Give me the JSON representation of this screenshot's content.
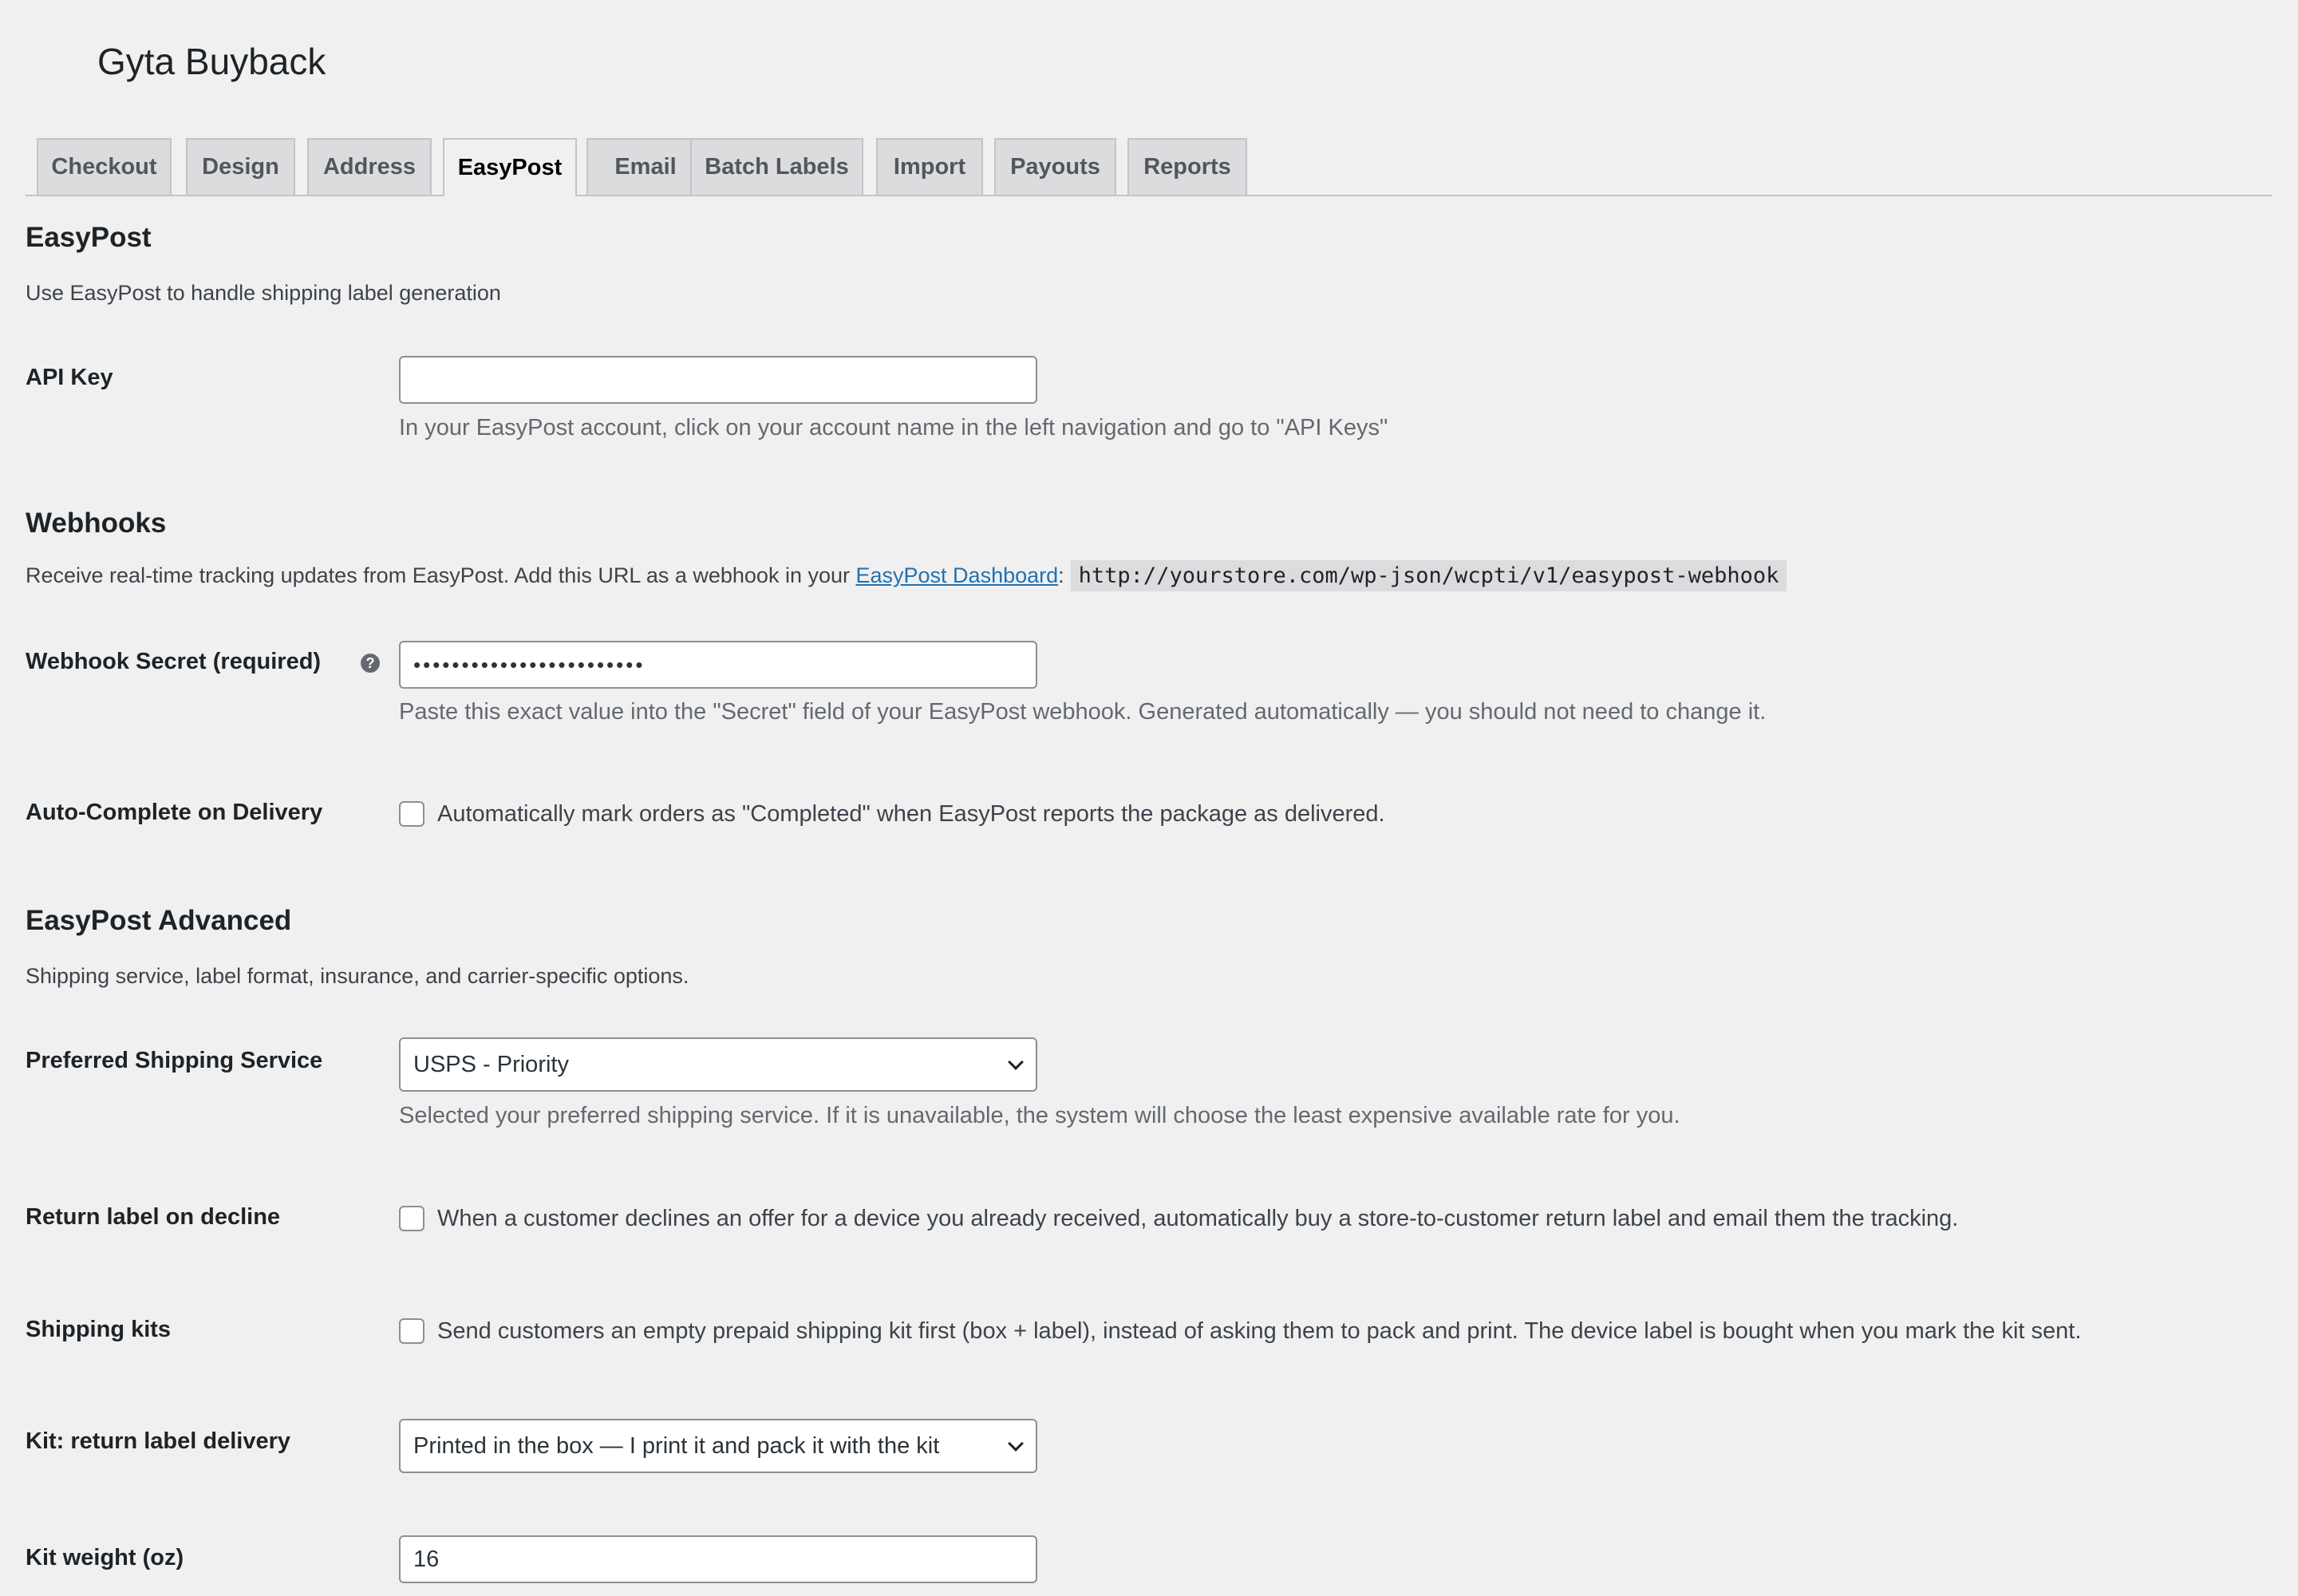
{
  "app": {
    "title": "Gyta Buyback"
  },
  "tabs": [
    {
      "label": "Checkout"
    },
    {
      "label": "Design"
    },
    {
      "label": "Address"
    },
    {
      "label": "EasyPost",
      "active": true
    },
    {
      "label": "Email"
    },
    {
      "label": "Batch Labels"
    },
    {
      "label": "Import"
    },
    {
      "label": "Payouts"
    },
    {
      "label": "Reports"
    }
  ],
  "easypost": {
    "title": "EasyPost",
    "description": "Use EasyPost to handle shipping label generation",
    "api_key": {
      "label": "API Key",
      "value": "",
      "help": "In your EasyPost account, click on your account name in the left navigation and go to \"API Keys\""
    }
  },
  "webhooks": {
    "title": "Webhooks",
    "description_prefix": "Receive real-time tracking updates from EasyPost. Add this URL as a webhook in your ",
    "link_text": "EasyPost Dashboard",
    "colon": ":",
    "url": "http://yourstore.com/wp-json/wcpti/v1/easypost-webhook",
    "secret": {
      "label": "Webhook Secret (required)",
      "help_icon": "question-icon",
      "value": "••••••••••••••••••••••••",
      "help": "Paste this exact value into the \"Secret\" field of your EasyPost webhook. Generated automatically — you should not need to change it."
    },
    "auto_complete": {
      "label": "Auto-Complete on Delivery",
      "checked": false,
      "text": "Automatically mark orders as \"Completed\" when EasyPost reports the package as delivered."
    }
  },
  "advanced": {
    "title": "EasyPost Advanced",
    "description": "Shipping service, label format, insurance, and carrier-specific options.",
    "preferred_service": {
      "label": "Preferred Shipping Service",
      "value": "USPS - Priority",
      "help": "Selected your preferred shipping service. If it is unavailable, the system will choose the least expensive available rate for you."
    },
    "return_label": {
      "label": "Return label on decline",
      "checked": false,
      "text": "When a customer declines an offer for a device you already received, automatically buy a store-to-customer return label and email them the tracking."
    },
    "shipping_kits": {
      "label": "Shipping kits",
      "checked": false,
      "text": "Send customers an empty prepaid shipping kit first (box + label), instead of asking them to pack and print. The device label is bought when you mark the kit sent."
    },
    "kit_return_delivery": {
      "label": "Kit: return label delivery",
      "value": "Printed in the box — I print it and pack it with the kit"
    },
    "kit_weight": {
      "label": "Kit weight (oz)",
      "value": "16"
    }
  }
}
